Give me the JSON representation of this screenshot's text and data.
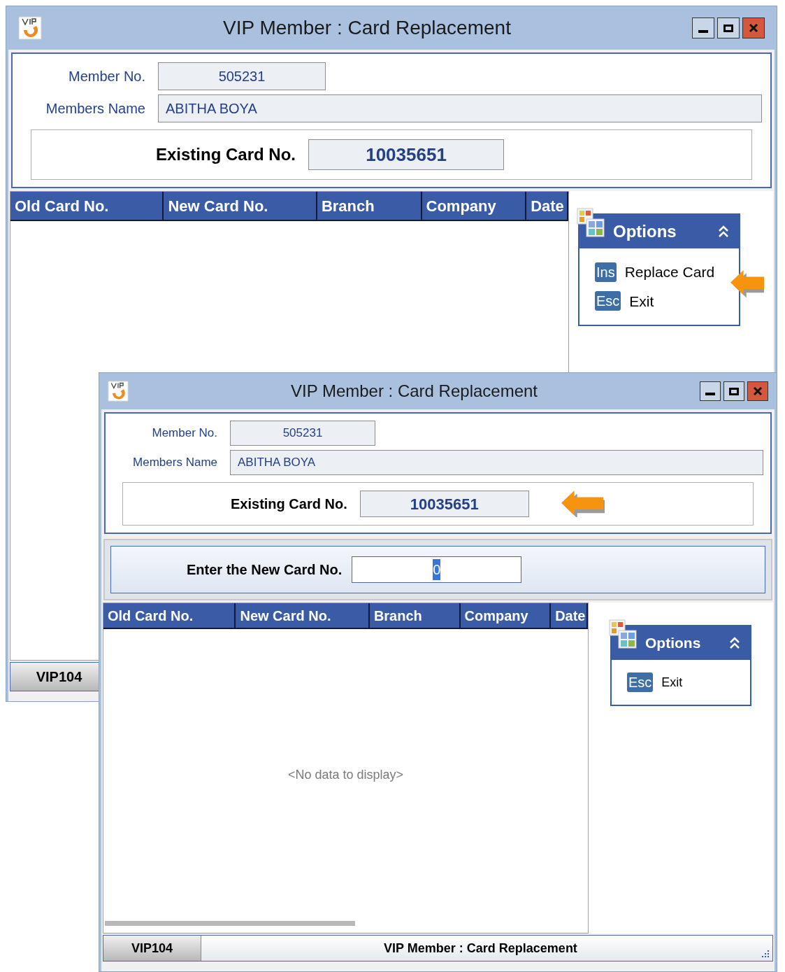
{
  "windows": [
    {
      "title": "VIP Member : Card Replacement",
      "member_no": {
        "label": "Member No.",
        "value": "505231"
      },
      "members_name": {
        "label": "Members Name",
        "value": "ABITHA BOYA"
      },
      "existing_card": {
        "label": "Existing Card No.",
        "value": "10035651"
      },
      "grid": {
        "columns": [
          "Old Card No.",
          "New Card No.",
          "Branch",
          "Company",
          "Date"
        ]
      },
      "options": {
        "title": "Options",
        "expanded": true,
        "items": [
          {
            "key": "Ins",
            "label": "Replace Card"
          },
          {
            "key": "Esc",
            "label": "Exit"
          }
        ]
      },
      "status_bar": {
        "code": "VIP104"
      }
    },
    {
      "title": "VIP Member : Card Replacement",
      "member_no": {
        "label": "Member No.",
        "value": "505231"
      },
      "members_name": {
        "label": "Members Name",
        "value": "ABITHA BOYA"
      },
      "existing_card": {
        "label": "Existing Card No.",
        "value": "10035651"
      },
      "new_card": {
        "label": "Enter the New Card No.",
        "value": "0",
        "text_selected": true
      },
      "grid": {
        "columns": [
          "Old Card No.",
          "New Card No.",
          "Branch",
          "Company",
          "Date"
        ],
        "empty_text": "<No data to display>"
      },
      "options": {
        "title": "Options",
        "expanded": true,
        "items": [
          {
            "key": "Esc",
            "label": "Exit"
          }
        ]
      },
      "status_bar": {
        "code": "VIP104",
        "title": "VIP Member : Card Replacement"
      }
    }
  ]
}
